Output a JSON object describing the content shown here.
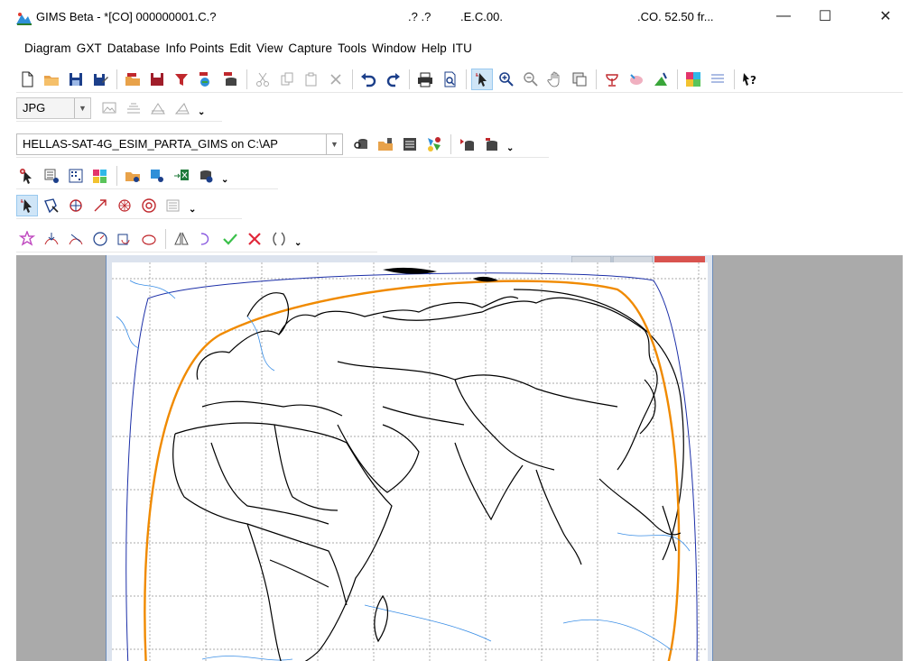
{
  "window": {
    "app_title": "GIMS Beta - *[CO] 000000001.C.?",
    "seg1": ".? .?",
    "seg2": ".E.C.00.",
    "seg3": ".CO.  52.50 fr...",
    "minimize": "—",
    "maximize": "☐",
    "close": "✕"
  },
  "menu": [
    "Diagram",
    "GXT",
    "Database",
    "Info Points",
    "Edit",
    "View",
    "Capture",
    "Tools",
    "Window",
    "Help",
    "ITU"
  ],
  "image_toolbar": {
    "format": "JPG"
  },
  "db_toolbar": {
    "database": "HELLAS-SAT-4G_ESIM_PARTA_GIMS on C:\\AP"
  },
  "colors": {
    "contour": "#f08a00",
    "coastline": "#000000",
    "rivers": "#3a8ee6",
    "grid": "#8c8c8c",
    "frame_blue": "#1c2fa8"
  }
}
